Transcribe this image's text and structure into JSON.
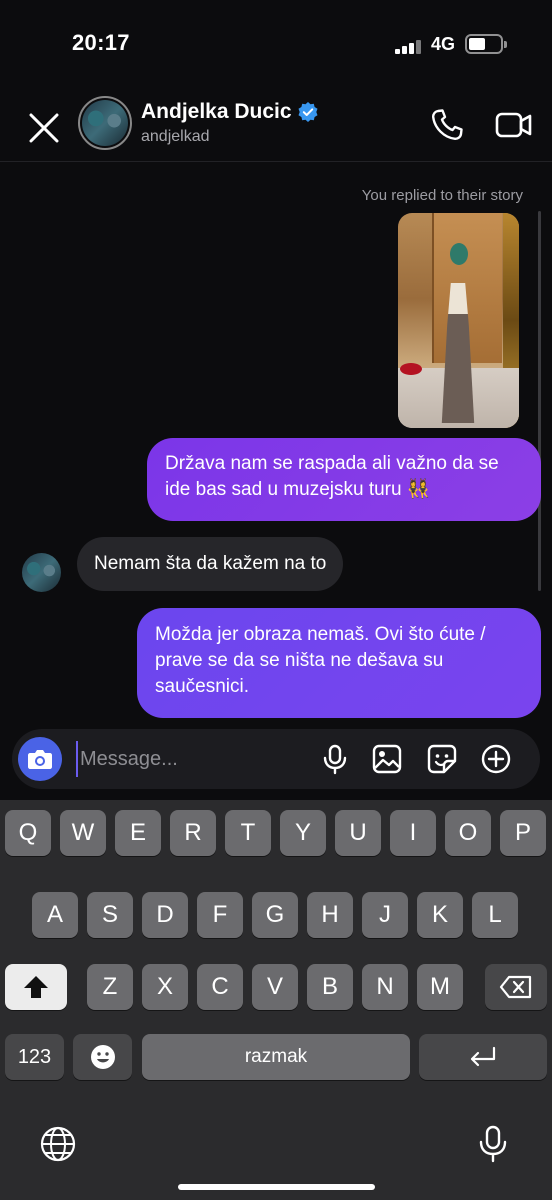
{
  "status_bar": {
    "time": "20:17",
    "network": "4G",
    "battery_level": 0.5
  },
  "header": {
    "name": "Andjelka Ducic",
    "username": "andjelkad",
    "verified": true
  },
  "thread": {
    "reply_label": "You replied to their story",
    "messages": [
      {
        "from": "me",
        "text": "Država nam se raspada ali važno da se ide bas sad u muzejsku turu 👯‍♀️"
      },
      {
        "from": "them",
        "text": "Nemam šta da kažem na to"
      },
      {
        "from": "me",
        "text": "Možda jer obraza nemaš. Ovi što ćute / prave se da se ništa ne dešava su saučesnici."
      }
    ]
  },
  "composer": {
    "placeholder": "Message..."
  },
  "keyboard": {
    "row1": [
      "Q",
      "W",
      "E",
      "R",
      "T",
      "Y",
      "U",
      "I",
      "O",
      "P"
    ],
    "row2": [
      "A",
      "S",
      "D",
      "F",
      "G",
      "H",
      "J",
      "K",
      "L"
    ],
    "row3": [
      "Z",
      "X",
      "C",
      "V",
      "B",
      "N",
      "M"
    ],
    "numbers_label": "123",
    "space_label": "razmak"
  },
  "colors": {
    "accent_purple": "#7b36e8",
    "accent_blue": "#4a63e6"
  }
}
